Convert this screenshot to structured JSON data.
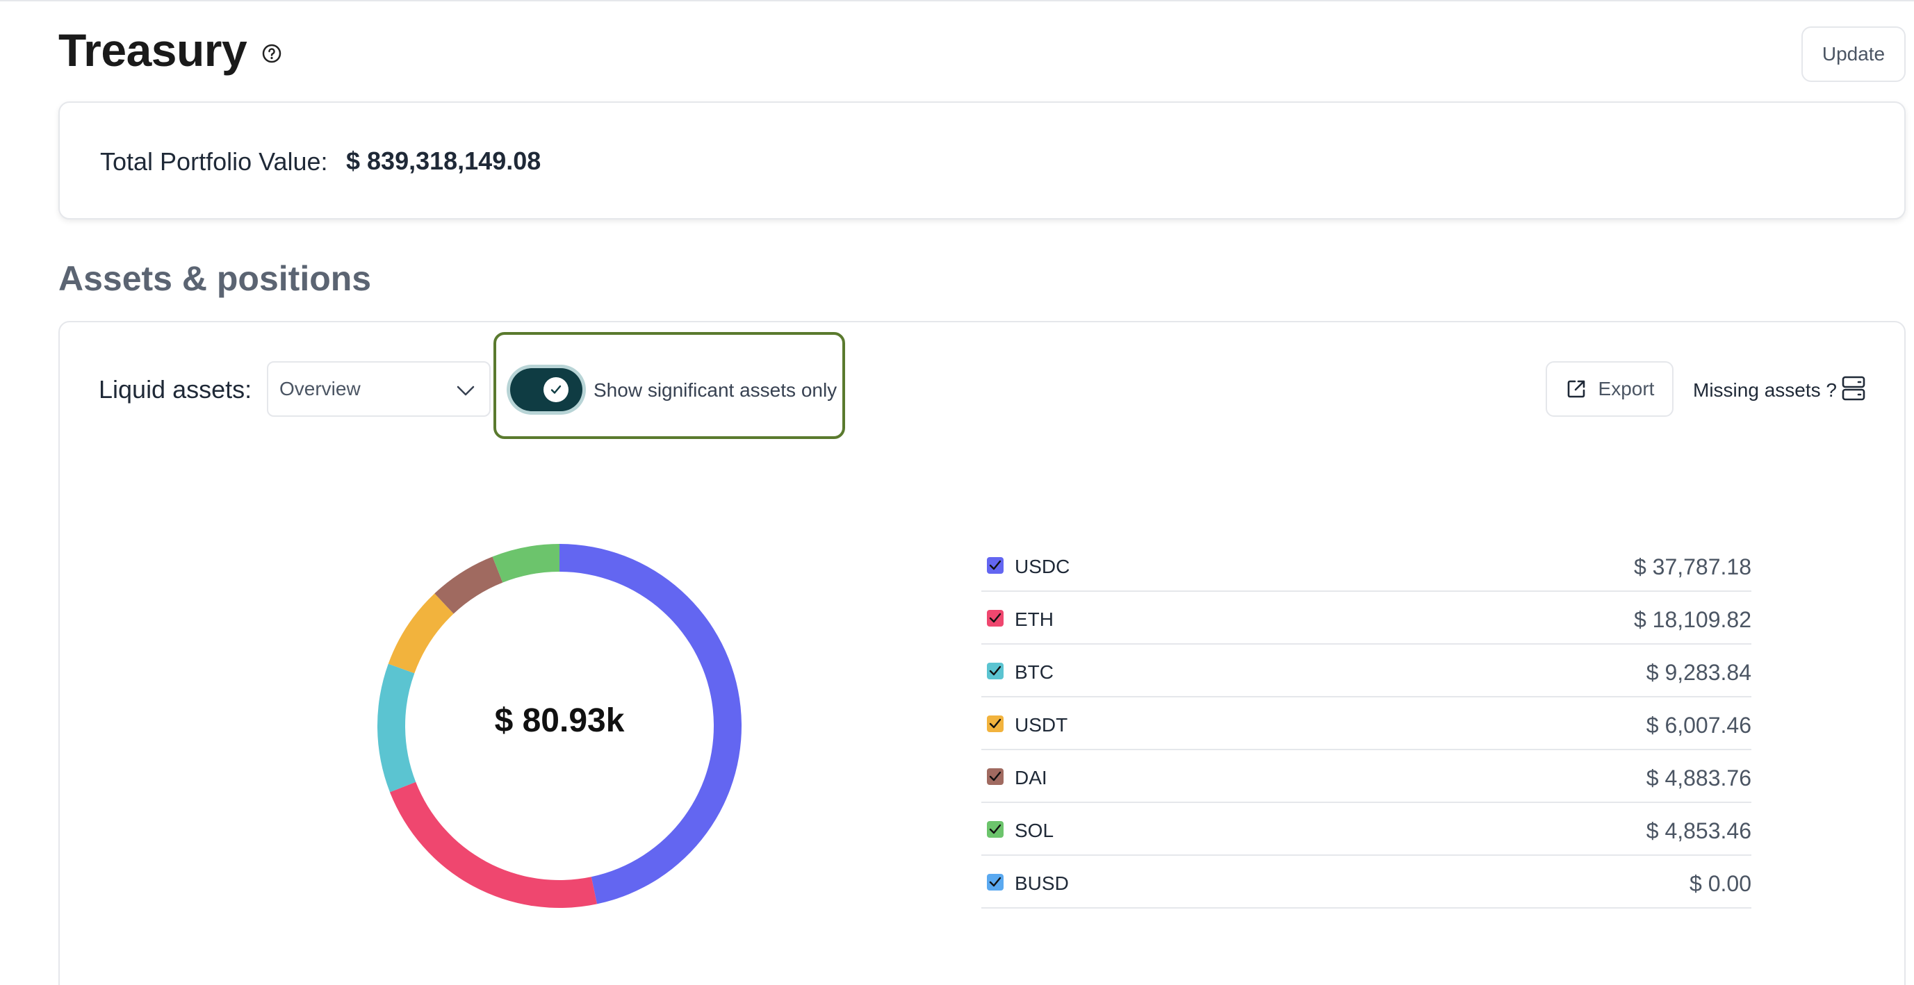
{
  "page": {
    "title": "Treasury",
    "update_label": "Update"
  },
  "portfolio": {
    "label": "Total Portfolio Value:",
    "value": "$ 839,318,149.08"
  },
  "section": {
    "title": "Assets & positions"
  },
  "controls": {
    "liquid_label": "Liquid assets:",
    "view_select": "Overview",
    "toggle_label": "Show significant assets only",
    "toggle_on": true,
    "export_label": "Export",
    "missing_label": "Missing assets ?"
  },
  "chart_data": {
    "type": "pie",
    "total_label": "$ 80.93k",
    "categories": [
      "USDC",
      "ETH",
      "BTC",
      "USDT",
      "DAI",
      "SOL",
      "BUSD"
    ],
    "values": [
      37787.18,
      18109.82,
      9283.84,
      6007.46,
      4883.76,
      4853.46,
      0.0
    ],
    "colors": [
      "#6366f1",
      "#ef476f",
      "#5bc4d1",
      "#f2b33d",
      "#a06a60",
      "#6cc46c",
      "#5aa9f0"
    ]
  },
  "legend": [
    {
      "name": "USDC",
      "amount": "$ 37,787.18",
      "color": "#6366f1"
    },
    {
      "name": "ETH",
      "amount": "$ 18,109.82",
      "color": "#ef476f"
    },
    {
      "name": "BTC",
      "amount": "$ 9,283.84",
      "color": "#5bc4d1"
    },
    {
      "name": "USDT",
      "amount": "$ 6,007.46",
      "color": "#f2b33d"
    },
    {
      "name": "DAI",
      "amount": "$ 4,883.76",
      "color": "#a06a60"
    },
    {
      "name": "SOL",
      "amount": "$ 4,853.46",
      "color": "#6cc46c"
    },
    {
      "name": "BUSD",
      "amount": "$ 0.00",
      "color": "#5aa9f0"
    }
  ],
  "icons": {
    "help": "help-circle-icon",
    "chevron": "chevron-down-icon",
    "check": "check-icon",
    "export": "external-link-icon",
    "missing": "server-icon"
  }
}
